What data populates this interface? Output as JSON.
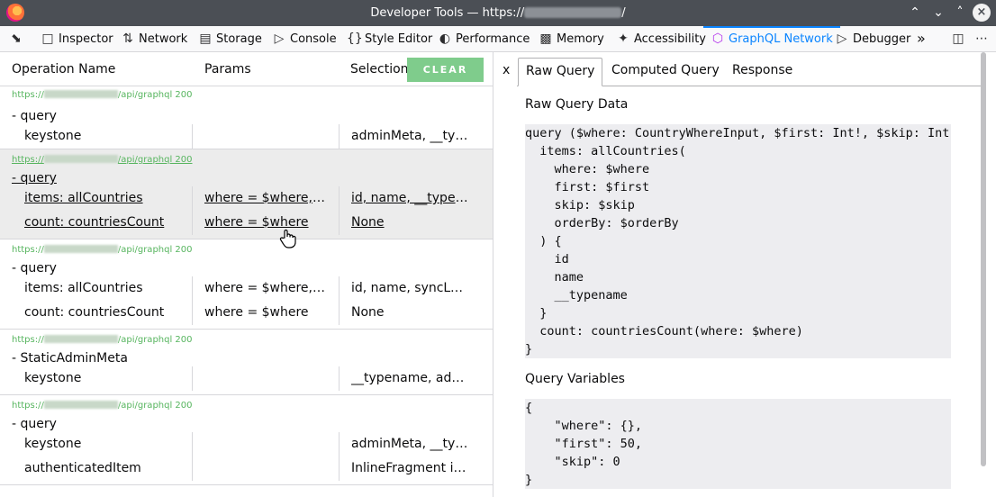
{
  "window": {
    "title_prefix": "Developer Tools — https://",
    "title_suffix": "/"
  },
  "toolbar": {
    "tabs": [
      {
        "label": "Inspector",
        "icon": "inspector-icon"
      },
      {
        "label": "Network",
        "icon": "network-icon"
      },
      {
        "label": "Storage",
        "icon": "storage-icon"
      },
      {
        "label": "Console",
        "icon": "console-icon"
      },
      {
        "label": "Style Editor",
        "icon": "style-editor-icon"
      },
      {
        "label": "Performance",
        "icon": "performance-icon"
      },
      {
        "label": "Memory",
        "icon": "memory-icon"
      },
      {
        "label": "Accessibility",
        "icon": "accessibility-icon"
      },
      {
        "label": "GraphQL Network",
        "icon": "graphql-icon",
        "active": true
      },
      {
        "label": "Debugger",
        "icon": "debugger-icon"
      }
    ],
    "overflow": "»"
  },
  "left": {
    "headers": {
      "operation": "Operation Name",
      "params": "Params",
      "selection": "Selection"
    },
    "clear_label": "CLEAR",
    "groups": [
      {
        "url_prefix": "https://",
        "url_suffix": "/api/graphql 200",
        "type": "- query",
        "rows": [
          {
            "name": "keystone",
            "params": "",
            "selection": "adminMeta, __typ…"
          }
        ]
      },
      {
        "url_prefix": "https://",
        "url_suffix": "/api/graphql 200",
        "type": "- query",
        "rows": [
          {
            "name": "items: allCountries",
            "params": "where = $where, fi…",
            "selection": "id, name, __typen…"
          },
          {
            "name": "count: countriesCount",
            "params": "where = $where",
            "selection": "None"
          }
        ]
      },
      {
        "url_prefix": "https://",
        "url_suffix": "/api/graphql 200",
        "type": "- query",
        "rows": [
          {
            "name": "items: allCountries",
            "params": "where = $where, fi…",
            "selection": "id, name, syncLoc…"
          },
          {
            "name": "count: countriesCount",
            "params": "where = $where",
            "selection": "None"
          }
        ]
      },
      {
        "url_prefix": "https://",
        "url_suffix": "/api/graphql 200",
        "type": "- StaticAdminMeta",
        "rows": [
          {
            "name": "keystone",
            "params": "",
            "selection": "__typename, admi…"
          }
        ]
      },
      {
        "url_prefix": "https://",
        "url_suffix": "/api/graphql 200",
        "type": "- query",
        "rows": [
          {
            "name": "keystone",
            "params": "",
            "selection": "adminMeta, __typ…"
          },
          {
            "name": "authenticatedItem",
            "params": "",
            "selection": "InlineFragment if …"
          }
        ]
      }
    ]
  },
  "right": {
    "close": "x",
    "tabs": [
      "Raw Query",
      "Computed Query",
      "Response"
    ],
    "raw_title": "Raw Query Data",
    "raw_query": "query ($where: CountryWhereInput, $first: Int!, $skip: Int!, $orderBy: [CountryOrderByInput!]) {\n  items: allCountries(\n    where: $where\n    first: $first\n    skip: $skip\n    orderBy: $orderBy\n  ) {\n    id\n    name\n    __typename\n  }\n  count: countriesCount(where: $where)\n}",
    "vars_title": "Query Variables",
    "variables": "{\n    \"where\": {},\n    \"first\": 50,\n    \"skip\": 0\n}"
  }
}
